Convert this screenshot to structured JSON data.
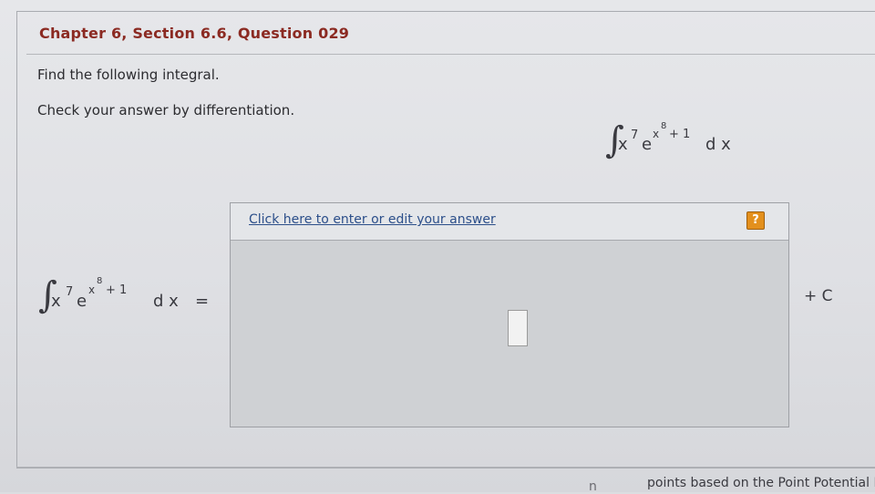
{
  "question": {
    "heading": "Chapter 6, Section 6.6, Question 029",
    "instruction_1": "Find the following integral.",
    "instruction_2": "Check your answer by differentiation."
  },
  "integral": {
    "sign": "∫",
    "base": "x",
    "base_power": "7",
    "e": "e",
    "exp_var": "x",
    "exp_power": "8",
    "exp_plus": "+ 1",
    "differential": "d x",
    "equals": "="
  },
  "answer": {
    "link_label": "Click here to enter or edit your answer",
    "help_label": "?",
    "constant": "+ C"
  },
  "footer": {
    "partial_text": "points based on the Point Potential Poli",
    "partial_left": "n"
  }
}
